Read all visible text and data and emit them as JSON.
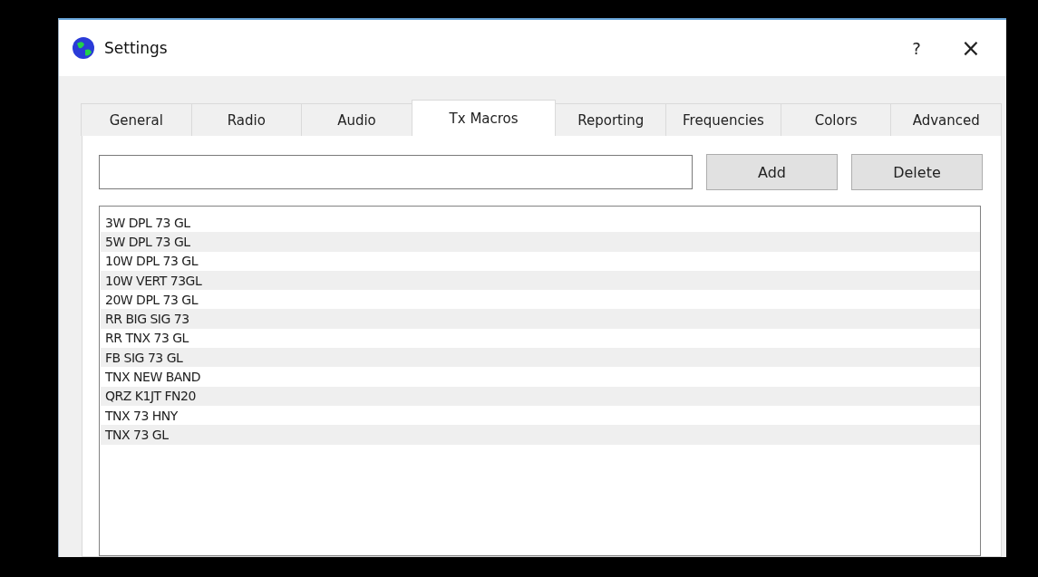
{
  "window": {
    "title": "Settings",
    "help": "?",
    "close": "×"
  },
  "tabs": [
    {
      "label": "General",
      "selected": false
    },
    {
      "label": "Radio",
      "selected": false
    },
    {
      "label": "Audio",
      "selected": false
    },
    {
      "label": "Tx Macros",
      "selected": true
    },
    {
      "label": "Reporting",
      "selected": false
    },
    {
      "label": "Frequencies",
      "selected": false
    },
    {
      "label": "Colors",
      "selected": false
    },
    {
      "label": "Advanced",
      "selected": false
    }
  ],
  "buttons": [
    "Add",
    "Delete"
  ],
  "macros": [
    {
      "text": "3W DPL 73 GL"
    },
    {
      "text": "5W DPL 73 GL"
    },
    {
      "text": "10W DPL 73 GL"
    },
    {
      "text": "10W VERT 73GL"
    },
    {
      "text": "20W DPL 73 GL"
    },
    {
      "text": "RR BIG SIG 73"
    },
    {
      "text": "RR TNX 73 GL"
    },
    {
      "text": "FB SIG 73 GL"
    },
    {
      "text": "TNX NEW BAND"
    },
    {
      "text": "QRZ K1JT FN20"
    },
    {
      "text": "TNX 73 HNY"
    },
    {
      "text": "TNX 73 GL"
    }
  ]
}
